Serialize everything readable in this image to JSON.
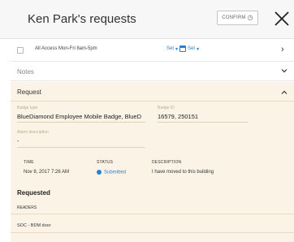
{
  "header": {
    "title": "Ken Park's requests",
    "confirm_label": "CONFIRM",
    "confirm_icon": "clock-icon",
    "close_icon": "close-x-icon"
  },
  "schedule": {
    "label": "All Access Mon-Fri 8am-5pm",
    "set_start": "Set",
    "set_end": "Set",
    "calendar_icon": "calendar-icon",
    "chevron_icon": "chevron-right-icon"
  },
  "notes": {
    "label": "Notes",
    "chevron_icon": "chevron-down-icon"
  },
  "request": {
    "heading": "Request",
    "chevron_icon": "chevron-up-icon",
    "badge_type_label": "Badge type",
    "badge_type_value": "BlueDiamond Employee Mobile Badge, BlueD",
    "badge_id_label": "Badge ID",
    "badge_id_value": "16579, 250151",
    "alarm_label": "Alarm description",
    "alarm_value": "-",
    "columns": {
      "time": "TIME",
      "status": "STATUS",
      "description": "DESCRIPTION"
    },
    "row": {
      "time": "Nov 8, 2017 7:26 AM",
      "status": "Submitted",
      "description": "I have moved to this building"
    },
    "status_color": "#2a7fd4",
    "panel_color": "#fbf4e6"
  },
  "requested": {
    "heading": "Requested",
    "readers_label": "READERS",
    "readers": [
      "SOC - BDM door"
    ]
  }
}
